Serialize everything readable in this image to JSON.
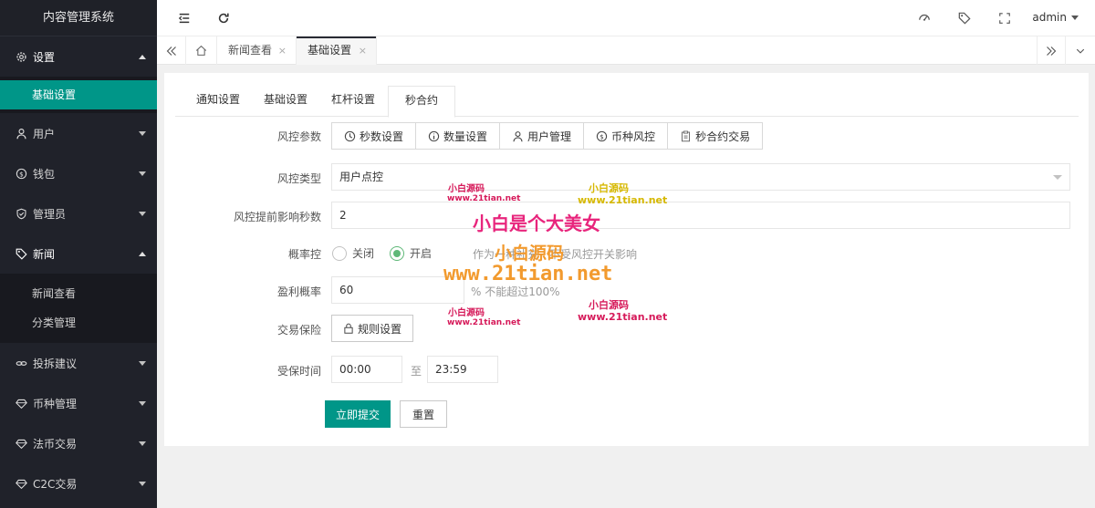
{
  "app": {
    "title": "内容管理系统"
  },
  "sidebar": {
    "items": [
      {
        "label": "设置",
        "icon": "gear-icon",
        "open": true
      },
      {
        "label": "用户",
        "icon": "user-icon"
      },
      {
        "label": "钱包",
        "icon": "dollar-icon"
      },
      {
        "label": "管理员",
        "icon": "shield-icon"
      },
      {
        "label": "新闻",
        "icon": "tag-icon",
        "open": true
      },
      {
        "label": "投拆建议",
        "icon": "link-icon"
      },
      {
        "label": "币种管理",
        "icon": "diamond-icon"
      },
      {
        "label": "法币交易",
        "icon": "diamond-icon"
      },
      {
        "label": "C2C交易",
        "icon": "diamond-icon"
      }
    ],
    "settings_sub": [
      "基础设置"
    ],
    "news_sub": [
      "新闻查看",
      "分类管理"
    ]
  },
  "header": {
    "user": "admin"
  },
  "page_tabs": [
    {
      "label": "新闻查看",
      "close": "×"
    },
    {
      "label": "基础设置",
      "close": "×",
      "active": true
    }
  ],
  "form_tabs": [
    "通知设置",
    "基础设置",
    "杠杆设置",
    "秒合约"
  ],
  "form": {
    "risk_params_label": "风控参数",
    "risk_buttons": [
      {
        "label": "秒数设置",
        "icon": "clock-icon"
      },
      {
        "label": "数量设置",
        "icon": "info-icon"
      },
      {
        "label": "用户管理",
        "icon": "user-icon"
      },
      {
        "label": "币种风控",
        "icon": "dollar-icon"
      },
      {
        "label": "秒合约交易",
        "icon": "clipboard-icon"
      }
    ],
    "risk_type_label": "风控类型",
    "risk_type_value": "用户点控",
    "advance_seconds_label": "风控提前影响秒数",
    "advance_seconds_value": "2",
    "probability_label": "概率控",
    "probability_off": "关闭",
    "probability_on": "开启",
    "probability_hint": "作为一种补充，不受风控开关影响",
    "profit_rate_label": "盈利概率",
    "profit_rate_value": "60",
    "profit_rate_hint": "%  不能超过100%",
    "insurance_label": "交易保险",
    "rules_button": "规则设置",
    "insured_time_label": "受保时间",
    "time_start": "00:00",
    "time_to": "至",
    "time_end": "23:59",
    "submit": "立即提交",
    "reset": "重置"
  },
  "watermarks": {
    "small_cn": "小白源码",
    "small_url": "www.21tian.net",
    "big_cn": "小白是个大美女",
    "big_url": "www.21tian.net"
  },
  "colors": {
    "accent": "#009688",
    "sidebar": "#20222a",
    "radio_on": "#5FB878"
  }
}
